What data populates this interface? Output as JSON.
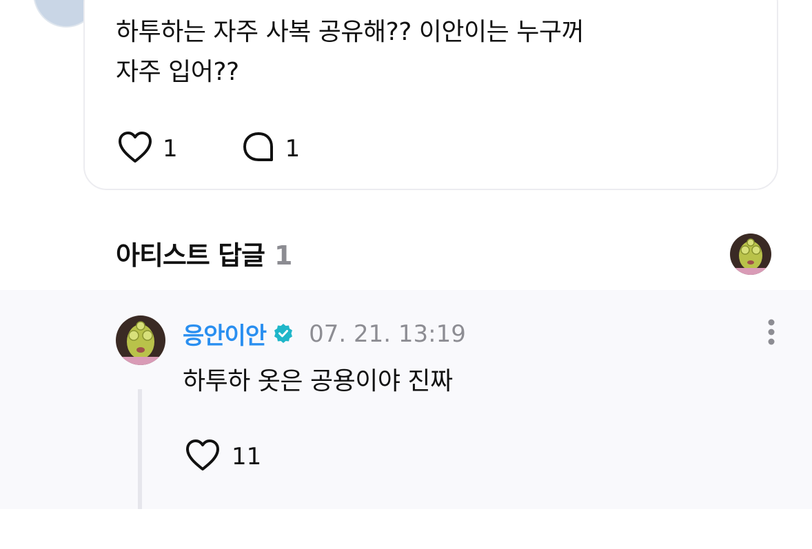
{
  "post": {
    "text_line1": "하투하는 자주 사복 공유해?? 이안이는 누구꺼",
    "text_line2": "자주 입어??",
    "like_count": "1",
    "comment_count": "1"
  },
  "artist_replies": {
    "title": "아티스트 답글",
    "count": "1"
  },
  "reply": {
    "author": "응안이안",
    "timestamp": "07. 21. 13:19",
    "text": "하투하 옷은 공용이야 진짜",
    "like_count": "11"
  },
  "colors": {
    "accent_blue": "#2a8ff0",
    "verified_teal": "#1fb6c9",
    "reply_bg": "#f9f9fc"
  },
  "icons": {
    "heart": "heart-icon",
    "comment": "comment-bubble-icon",
    "verified": "verified-badge-icon",
    "more": "more-vertical-icon"
  }
}
